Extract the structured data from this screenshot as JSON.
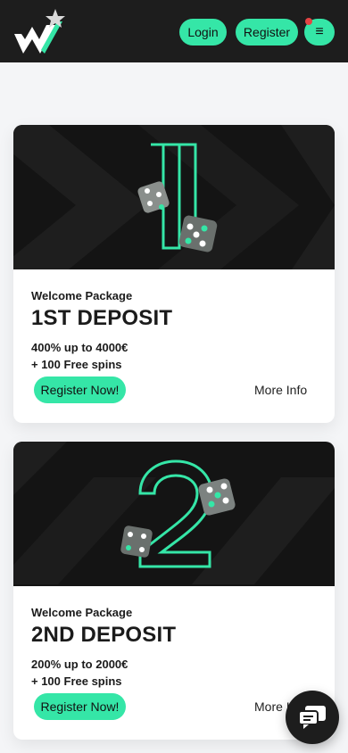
{
  "header": {
    "login_label": "Login",
    "register_label": "Register",
    "menu_icon": "≡",
    "logo_icon": "w-star-logo-icon"
  },
  "cards": [
    {
      "eyebrow": "Welcome Package",
      "title": "1ST DEPOSIT",
      "offer_line1": "400% up to 4000€",
      "offer_line2": "+ 100 Free spins",
      "cta_label": "Register Now!",
      "more_label": "More Info"
    },
    {
      "eyebrow": "Welcome Package",
      "title": "2ND DEPOSIT",
      "offer_line1": "200% up to 2000€",
      "offer_line2": "+ 100 Free spins",
      "cta_label": "Register Now!",
      "more_label": "More Info"
    }
  ],
  "colors": {
    "accent": "#35e6a7",
    "header_bg": "#1d1d1d",
    "notification": "#e54444"
  }
}
